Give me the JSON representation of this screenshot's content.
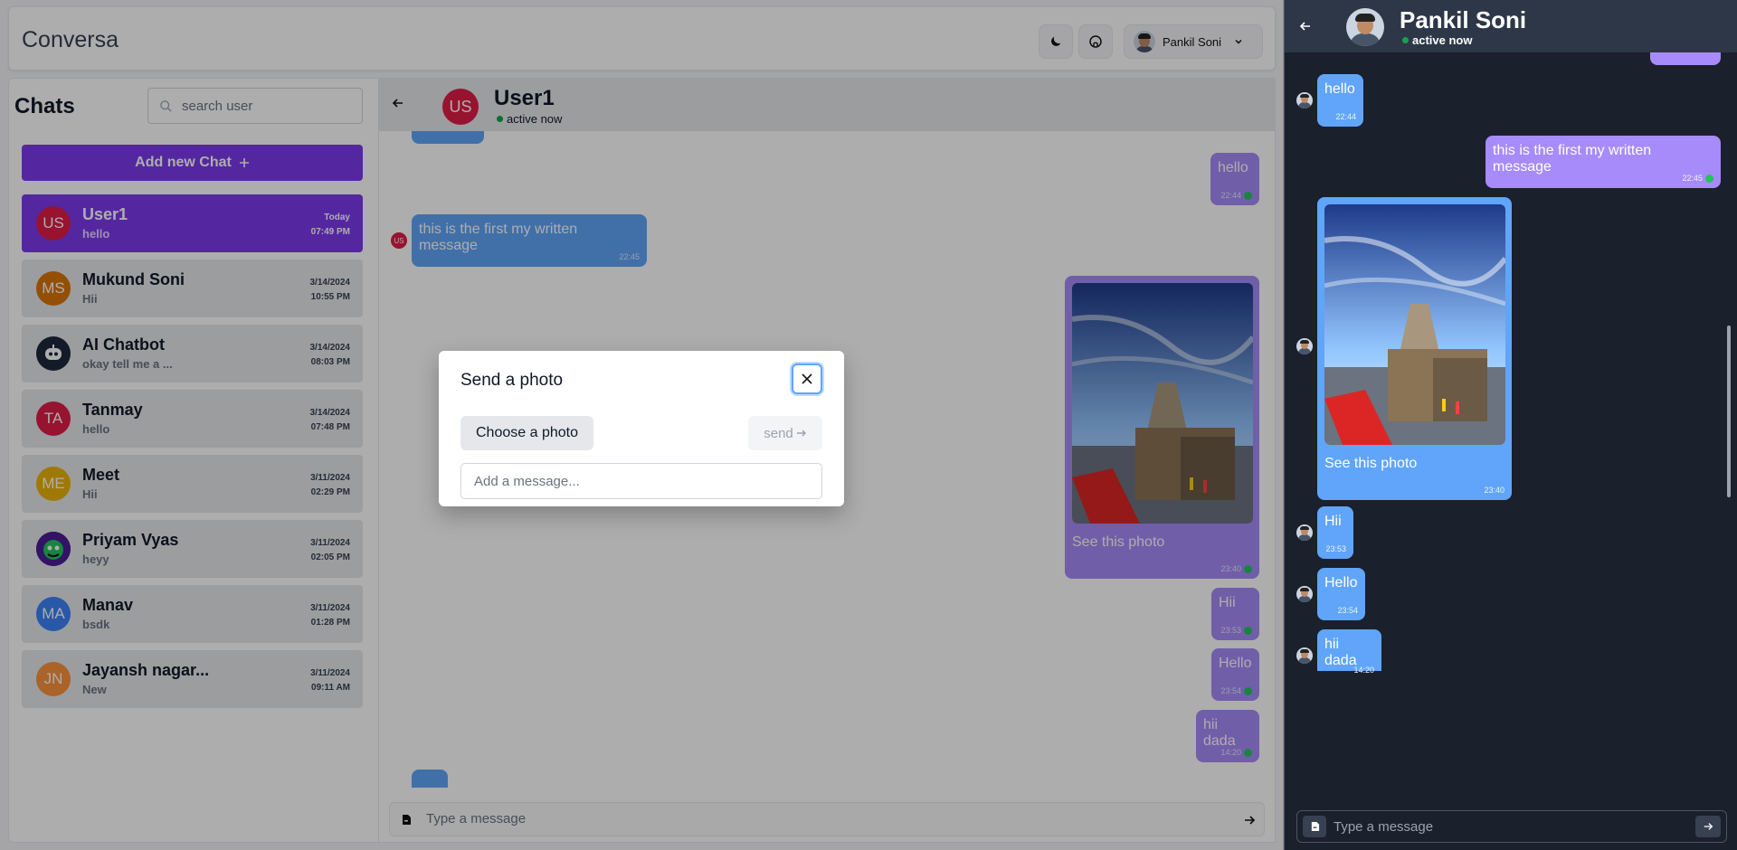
{
  "app": {
    "brand": "Conversa",
    "user_name": "Pankil Soni"
  },
  "sidebar": {
    "title": "Chats",
    "search_placeholder": "search user",
    "add_chat_label": "Add new Chat",
    "items": [
      {
        "initials": "US",
        "name": "User1",
        "preview": "hello",
        "date": "Today",
        "time": "07:49 PM",
        "color": "#e11d48"
      },
      {
        "initials": "MS",
        "name": "Mukund Soni",
        "preview": "Hii",
        "date": "3/14/2024",
        "time": "10:55 PM",
        "color": "#d97706"
      },
      {
        "initials": "",
        "name": "AI Chatbot",
        "preview": "okay tell me a ...",
        "date": "3/14/2024",
        "time": "08:03 PM",
        "color": "#1e293b"
      },
      {
        "initials": "TA",
        "name": "Tanmay",
        "preview": "hello",
        "date": "3/14/2024",
        "time": "07:48 PM",
        "color": "#e11d48"
      },
      {
        "initials": "ME",
        "name": "Meet",
        "preview": "Hii",
        "date": "3/11/2024",
        "time": "02:29 PM",
        "color": "#eab308"
      },
      {
        "initials": "",
        "name": "Priyam Vyas",
        "preview": "heyy",
        "date": "3/11/2024",
        "time": "02:05 PM",
        "color": "#4c1d95"
      },
      {
        "initials": "MA",
        "name": "Manav",
        "preview": "bsdk",
        "date": "3/11/2024",
        "time": "01:28 PM",
        "color": "#3b82f6"
      },
      {
        "initials": "JN",
        "name": "Jayansh nagar...",
        "preview": "New",
        "date": "3/11/2024",
        "time": "09:11 AM",
        "color": "#fb923c"
      }
    ]
  },
  "chat": {
    "avatar_initials": "US",
    "name": "User1",
    "status": "active now",
    "input_placeholder": "Type a message",
    "messages": [
      {
        "text": "hello",
        "time": "22:44",
        "dir": "out"
      },
      {
        "text": "this is the first my written message",
        "time": "22:45",
        "dir": "in",
        "sender": "US"
      },
      {
        "text": "See this photo",
        "time": "23:40",
        "dir": "out"
      },
      {
        "text": "Hii",
        "time": "23:53",
        "dir": "out"
      },
      {
        "text": "Hello",
        "time": "23:54",
        "dir": "out"
      },
      {
        "text": "hii dada",
        "time": "14:20",
        "dir": "out"
      }
    ]
  },
  "modal": {
    "title": "Send a photo",
    "choose_label": "Choose a photo",
    "send_label": "send",
    "message_placeholder": "Add a message..."
  },
  "right": {
    "name": "Pankil Soni",
    "status": "active now",
    "input_placeholder": "Type a message",
    "messages": [
      {
        "text": "hello",
        "time": "22:44",
        "dir": "in"
      },
      {
        "text": "this is the first my written message",
        "time": "22:45",
        "dir": "out"
      },
      {
        "text": "See this photo",
        "time": "23:40",
        "dir": "in"
      },
      {
        "text": "Hii",
        "time": "23:53",
        "dir": "in"
      },
      {
        "text": "Hello",
        "time": "23:54",
        "dir": "in"
      },
      {
        "text": "hii dada",
        "time": "14:20",
        "dir": "in"
      }
    ]
  },
  "colors": {
    "accent": "#7c3aed",
    "incoming": "#60a5fa",
    "outgoing": "#a78bfa",
    "online": "#16a34a",
    "dark_bg": "#1a202c"
  }
}
